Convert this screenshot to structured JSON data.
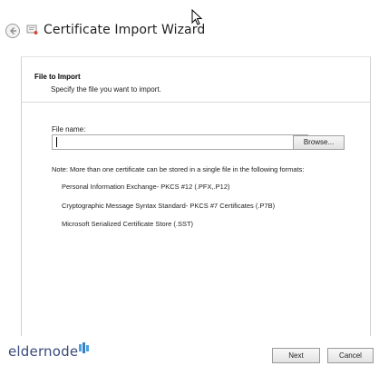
{
  "window": {
    "title": "Certificate Import Wizard"
  },
  "section": {
    "title": "File to Import",
    "subtitle": "Specify the file you want to import."
  },
  "file": {
    "label": "File name:",
    "value": "",
    "browse_label": "Browse..."
  },
  "note": "Note:  More than one certificate can be stored in a single file in the following formats:",
  "formats": [
    "Personal Information Exchange- PKCS #12 (.PFX,.P12)",
    "Cryptographic Message Syntax Standard- PKCS #7 Certificates (.P7B)",
    "Microsoft Serialized Certificate Store (.SST)"
  ],
  "footer": {
    "logo_text": "eldernode",
    "next_label": "Next",
    "cancel_label": "Cancel"
  },
  "icons": {
    "back": "back-arrow-icon",
    "wizard": "certificate-icon",
    "cursor": "mouse-cursor-icon"
  },
  "colors": {
    "logo": "#3a4a7a",
    "logo_accent": "#4aa3df"
  }
}
